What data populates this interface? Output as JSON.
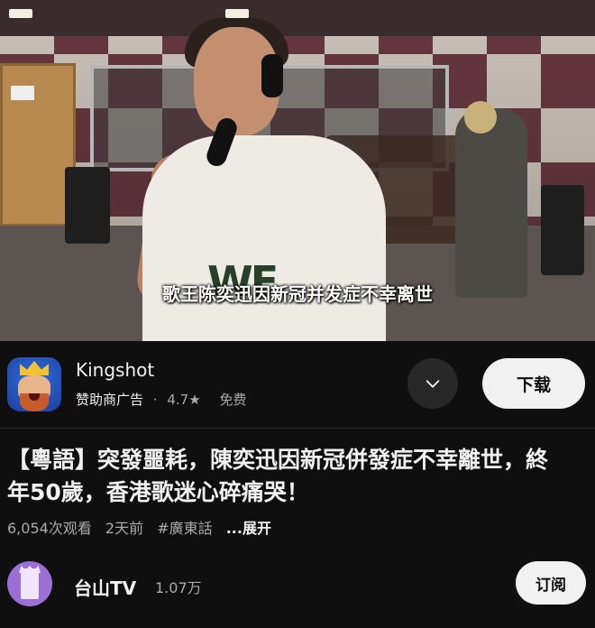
{
  "video": {
    "subtitle": "歌王陈奕迅因新冠并发症不幸离世",
    "shirt_logo": "WE"
  },
  "ad": {
    "app_name": "Kingshot",
    "sponsor_label": "赞助商广告",
    "separator": "·",
    "rating": "4.7★",
    "price": "免费",
    "download_label": "下载",
    "icon": "chevron-down-icon"
  },
  "video_info": {
    "title": "【粵語】突發噩耗，陳奕迅因新冠併發症不幸離世，終年50歲，香港歌迷心碎痛哭！",
    "views": "6,054次观看",
    "age": "2天前",
    "hashtag": "#廣東話",
    "more_label": "...展开"
  },
  "channel": {
    "name": "台山TV",
    "subscribers": "1.07万",
    "subscribe_label": "订阅"
  },
  "colors": {
    "background": "#0f0f0f",
    "text_primary": "#f1f1f1",
    "text_secondary": "#aaaaaa",
    "button_light": "#f1f1f1",
    "button_dark": "#272727"
  }
}
